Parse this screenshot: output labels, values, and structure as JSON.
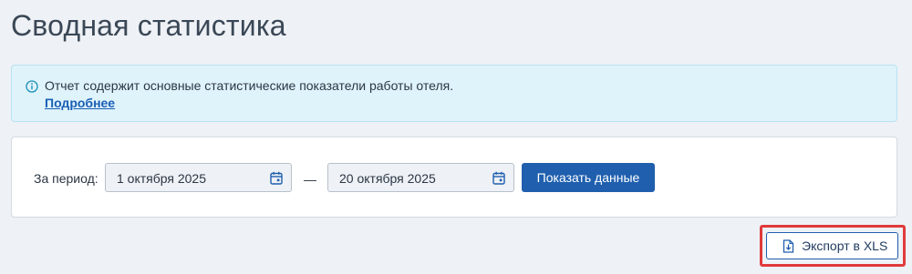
{
  "page": {
    "title": "Сводная статистика"
  },
  "info": {
    "icon": "info-icon",
    "text": "Отчет содержит основные статистические показатели работы отеля.",
    "link_label": "Подробнее"
  },
  "filter": {
    "period_label": "За период:",
    "date_from": "1 октября 2025",
    "date_to": "20 октября 2025",
    "separator": "—",
    "calendar_icon": "calendar-icon",
    "submit_label": "Показать данные"
  },
  "export": {
    "label": "Экспорт в XLS",
    "icon": "file-download-icon"
  },
  "colors": {
    "primary": "#1f5fae",
    "info_bg": "#dff3fb",
    "highlight": "#e03a3a"
  }
}
